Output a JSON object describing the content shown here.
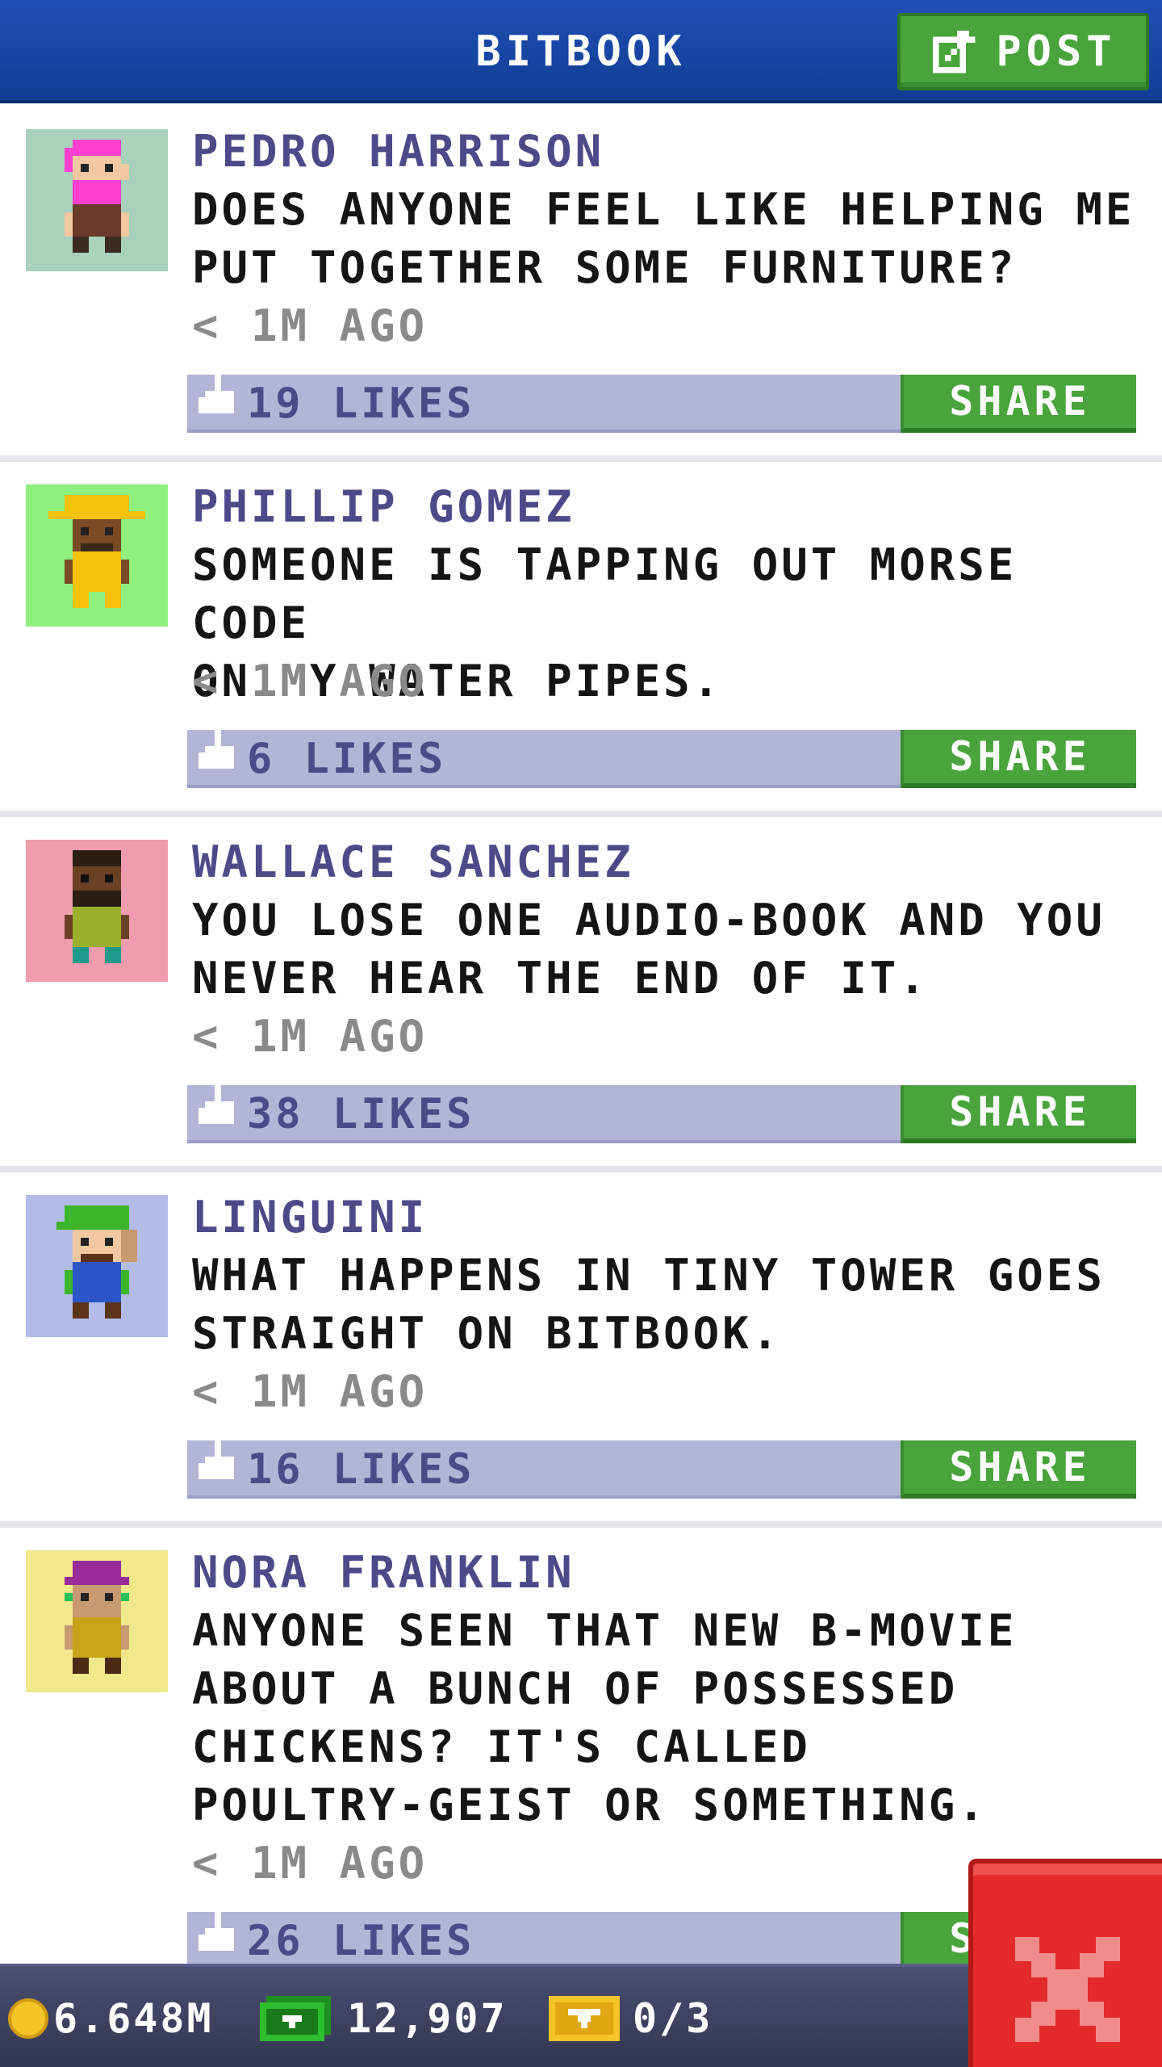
{
  "header": {
    "title": "BITBOOK",
    "post_label": "POST"
  },
  "posts": [
    {
      "author": "PEDRO HARRISON",
      "text": "DOES ANYONE FEEL LIKE HELPING ME\nPUT TOGETHER SOME FURNITURE?",
      "time": "< 1M AGO",
      "likes": "19 LIKES",
      "share": "SHARE",
      "avatar_bg": "#a9d1bb"
    },
    {
      "author": "PHILLIP GOMEZ",
      "text": "SOMEONE IS TAPPING OUT MORSE CODE\nON MY WATER PIPES.",
      "time": "< 1M AGO",
      "likes": "6 LIKES",
      "share": "SHARE",
      "avatar_bg": "#8ff07d"
    },
    {
      "author": "WALLACE SANCHEZ",
      "text": "YOU LOSE ONE AUDIO-BOOK AND YOU\nNEVER HEAR THE END OF IT.",
      "time": "< 1M AGO",
      "likes": "38 LIKES",
      "share": "SHARE",
      "avatar_bg": "#ef9cae"
    },
    {
      "author": "LINGUINI",
      "text": "WHAT HAPPENS IN TINY TOWER GOES\nSTRAIGHT ON BITBOOK.",
      "time": "< 1M AGO",
      "likes": "16 LIKES",
      "share": "SHARE",
      "avatar_bg": "#b3bce6"
    },
    {
      "author": "NORA FRANKLIN",
      "text": "ANYONE SEEN THAT NEW B-MOVIE\nABOUT A BUNCH OF POSSESSED\nCHICKENS? IT'S CALLED\nPOULTRY-GEIST OR SOMETHING.",
      "time": "< 1M AGO",
      "likes": "26 LIKES",
      "share": "SHARE",
      "avatar_bg": "#f1e88c"
    }
  ],
  "footer": {
    "coins": "6.648M",
    "bux": "12,907",
    "tickets": "0/3"
  },
  "colors": {
    "header_blue": "#1a47a8",
    "share_green": "#48a43b",
    "like_bar": "#b3b5d6",
    "close_red": "#e42b2b"
  }
}
